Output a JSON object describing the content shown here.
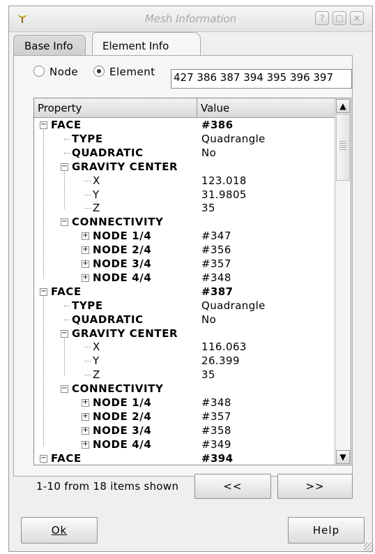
{
  "window": {
    "title": "Mesh Information"
  },
  "tabs": [
    {
      "label": "Base Info"
    },
    {
      "label": "Element Info"
    }
  ],
  "mode": {
    "node_label": "Node",
    "element_label": "Element",
    "selected": "Element"
  },
  "ids_field": {
    "value": "427 386 387 394 395 396 397"
  },
  "columns": {
    "property": "Property",
    "value": "Value"
  },
  "rows": [
    {
      "label": "FACE",
      "value": "#386",
      "bold": true
    },
    {
      "label": "TYPE",
      "value": "Quadrangle"
    },
    {
      "label": "QUADRATIC",
      "value": "No"
    },
    {
      "label": "GRAVITY CENTER",
      "value": ""
    },
    {
      "label": "X",
      "value": "123.018"
    },
    {
      "label": "Y",
      "value": "31.9805"
    },
    {
      "label": "Z",
      "value": "35"
    },
    {
      "label": "CONNECTIVITY",
      "value": ""
    },
    {
      "label": "NODE 1/4",
      "value": "#347"
    },
    {
      "label": "NODE 2/4",
      "value": "#356"
    },
    {
      "label": "NODE 3/4",
      "value": "#357"
    },
    {
      "label": "NODE 4/4",
      "value": "#348"
    },
    {
      "label": "FACE",
      "value": "#387",
      "bold": true
    },
    {
      "label": "TYPE",
      "value": "Quadrangle"
    },
    {
      "label": "QUADRATIC",
      "value": "No"
    },
    {
      "label": "GRAVITY CENTER",
      "value": ""
    },
    {
      "label": "X",
      "value": "116.063"
    },
    {
      "label": "Y",
      "value": "26.399"
    },
    {
      "label": "Z",
      "value": "35"
    },
    {
      "label": "CONNECTIVITY",
      "value": ""
    },
    {
      "label": "NODE 1/4",
      "value": "#348"
    },
    {
      "label": "NODE 2/4",
      "value": "#357"
    },
    {
      "label": "NODE 3/4",
      "value": "#358"
    },
    {
      "label": "NODE 4/4",
      "value": "#349"
    },
    {
      "label": "FACE",
      "value": "#394",
      "bold": true
    }
  ],
  "pager": {
    "status": "1-10 from 18 items shown",
    "prev": "<<",
    "next": ">>"
  },
  "footer": {
    "ok": "Ok",
    "help": "Help"
  }
}
